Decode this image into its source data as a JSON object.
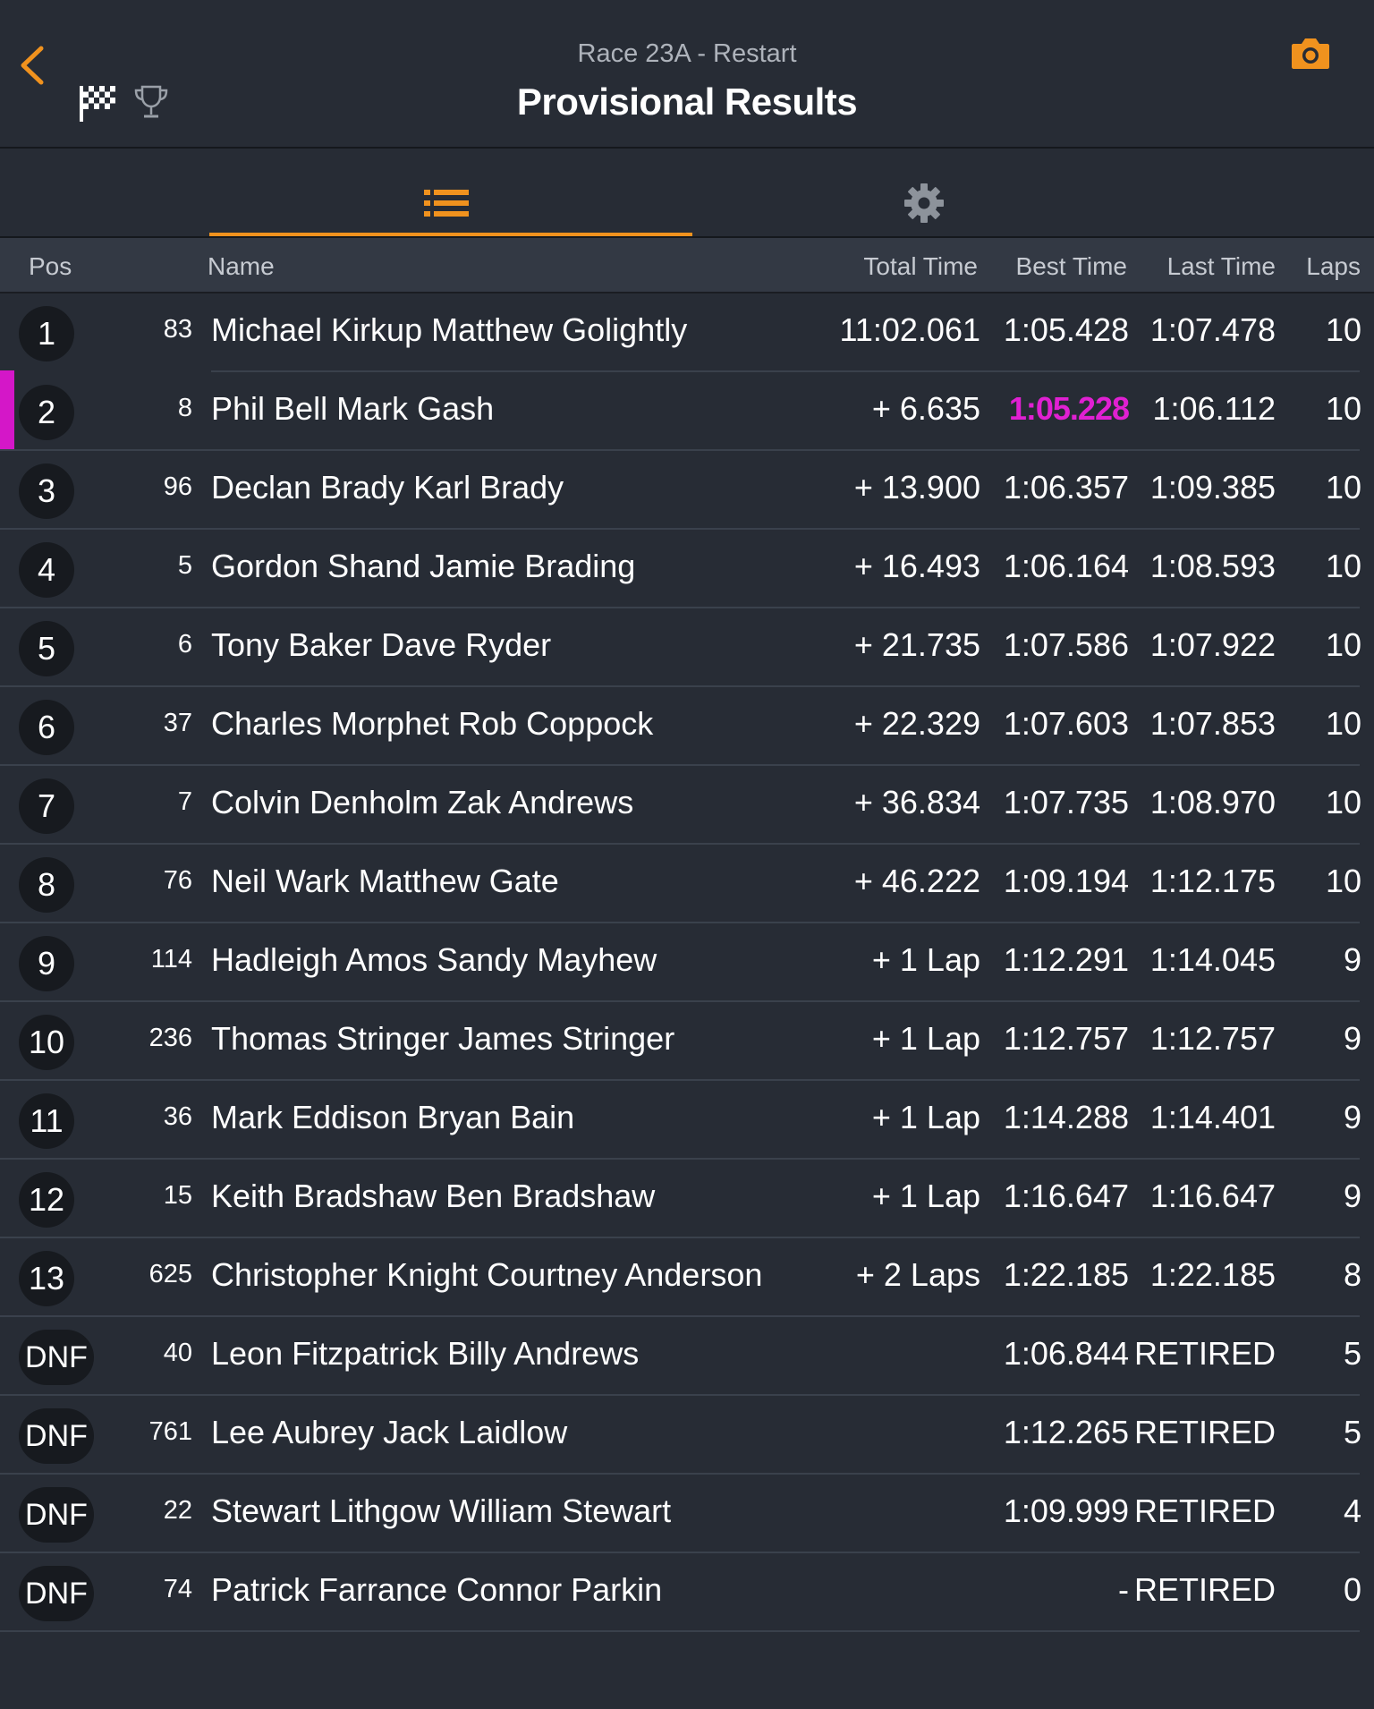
{
  "header": {
    "subtitle": "Race 23A - Restart",
    "title": "Provisional Results"
  },
  "columns": {
    "pos": "Pos",
    "name": "Name",
    "total_time": "Total Time",
    "best_time": "Best Time",
    "last_time": "Last Time",
    "laps": "Laps"
  },
  "colors": {
    "accent": "#f0921e",
    "fastest": "#e020d2",
    "background": "#272c35"
  },
  "rows": [
    {
      "pos": "1",
      "num": "83",
      "name": "Michael Kirkup Matthew Golightly",
      "total": "11:02.061",
      "best": "1:05.428",
      "last": "1:07.478",
      "laps": "10"
    },
    {
      "pos": "2",
      "num": "8",
      "name": "Phil Bell Mark Gash",
      "total": "+ 6.635",
      "best": "1:05.228",
      "last": "1:06.112",
      "laps": "10"
    },
    {
      "pos": "3",
      "num": "96",
      "name": "Declan Brady Karl Brady",
      "total": "+ 13.900",
      "best": "1:06.357",
      "last": "1:09.385",
      "laps": "10"
    },
    {
      "pos": "4",
      "num": "5",
      "name": "Gordon Shand Jamie Brading",
      "total": "+ 16.493",
      "best": "1:06.164",
      "last": "1:08.593",
      "laps": "10"
    },
    {
      "pos": "5",
      "num": "6",
      "name": "Tony Baker Dave Ryder",
      "total": "+ 21.735",
      "best": "1:07.586",
      "last": "1:07.922",
      "laps": "10"
    },
    {
      "pos": "6",
      "num": "37",
      "name": "Charles Morphet Rob Coppock",
      "total": "+ 22.329",
      "best": "1:07.603",
      "last": "1:07.853",
      "laps": "10"
    },
    {
      "pos": "7",
      "num": "7",
      "name": "Colvin Denholm Zak Andrews",
      "total": "+ 36.834",
      "best": "1:07.735",
      "last": "1:08.970",
      "laps": "10"
    },
    {
      "pos": "8",
      "num": "76",
      "name": "Neil Wark Matthew Gate",
      "total": "+ 46.222",
      "best": "1:09.194",
      "last": "1:12.175",
      "laps": "10"
    },
    {
      "pos": "9",
      "num": "114",
      "name": "Hadleigh Amos Sandy Mayhew",
      "total": "+ 1 Lap",
      "best": "1:12.291",
      "last": "1:14.045",
      "laps": "9"
    },
    {
      "pos": "10",
      "num": "236",
      "name": "Thomas Stringer James Stringer",
      "total": "+ 1 Lap",
      "best": "1:12.757",
      "last": "1:12.757",
      "laps": "9"
    },
    {
      "pos": "11",
      "num": "36",
      "name": "Mark Eddison Bryan Bain",
      "total": "+ 1 Lap",
      "best": "1:14.288",
      "last": "1:14.401",
      "laps": "9"
    },
    {
      "pos": "12",
      "num": "15",
      "name": "Keith Bradshaw Ben Bradshaw",
      "total": "+ 1 Lap",
      "best": "1:16.647",
      "last": "1:16.647",
      "laps": "9"
    },
    {
      "pos": "13",
      "num": "625",
      "name": "Christopher Knight Courtney Anderson",
      "total": "+ 2 Laps",
      "best": "1:22.185",
      "last": "1:22.185",
      "laps": "8"
    },
    {
      "pos": "DNF",
      "num": "40",
      "name": "Leon Fitzpatrick Billy Andrews",
      "total": "",
      "best": "1:06.844",
      "last": "RETIRED",
      "laps": "5"
    },
    {
      "pos": "DNF",
      "num": "761",
      "name": "Lee Aubrey Jack Laidlow",
      "total": "",
      "best": "1:12.265",
      "last": "RETIRED",
      "laps": "5"
    },
    {
      "pos": "DNF",
      "num": "22",
      "name": "Stewart Lithgow William Stewart",
      "total": "",
      "best": "1:09.999",
      "last": "RETIRED",
      "laps": "4"
    },
    {
      "pos": "DNF",
      "num": "74",
      "name": "Patrick Farrance Connor Parkin",
      "total": "",
      "best": "-",
      "last": "RETIRED",
      "laps": "0"
    }
  ]
}
